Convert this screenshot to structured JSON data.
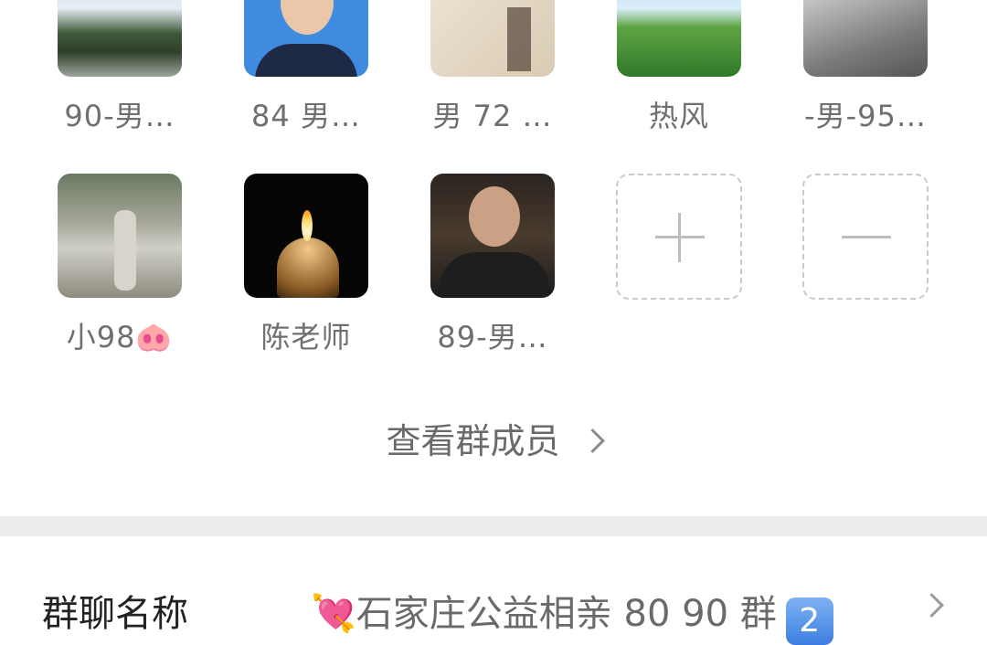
{
  "members": [
    {
      "name": "90-男…",
      "avatar": "landscape-photo"
    },
    {
      "name": "84 男…",
      "avatar": "portrait-photo"
    },
    {
      "name": "男 72 …",
      "avatar": "calligraphy-image"
    },
    {
      "name": "热风",
      "avatar": "trees-photo"
    },
    {
      "name": "-男-95…",
      "avatar": "sunlight-photo"
    },
    {
      "name": "小98🐽",
      "avatar": "person-outdoor-photo"
    },
    {
      "name": "陈老师",
      "avatar": "candle-photo"
    },
    {
      "name": "89-男…",
      "avatar": "man-selfie-photo"
    }
  ],
  "actions": {
    "add_icon": "plus-icon",
    "remove_icon": "minus-icon"
  },
  "view_members": {
    "label": "查看群成员"
  },
  "group_name_row": {
    "label": "群聊名称",
    "value": "💘石家庄公益相亲 80 90 群",
    "badge": "2"
  },
  "colors": {
    "divider": "#ededed",
    "name_text": "#6f6f6f",
    "dash_border": "#c9c9c9"
  }
}
